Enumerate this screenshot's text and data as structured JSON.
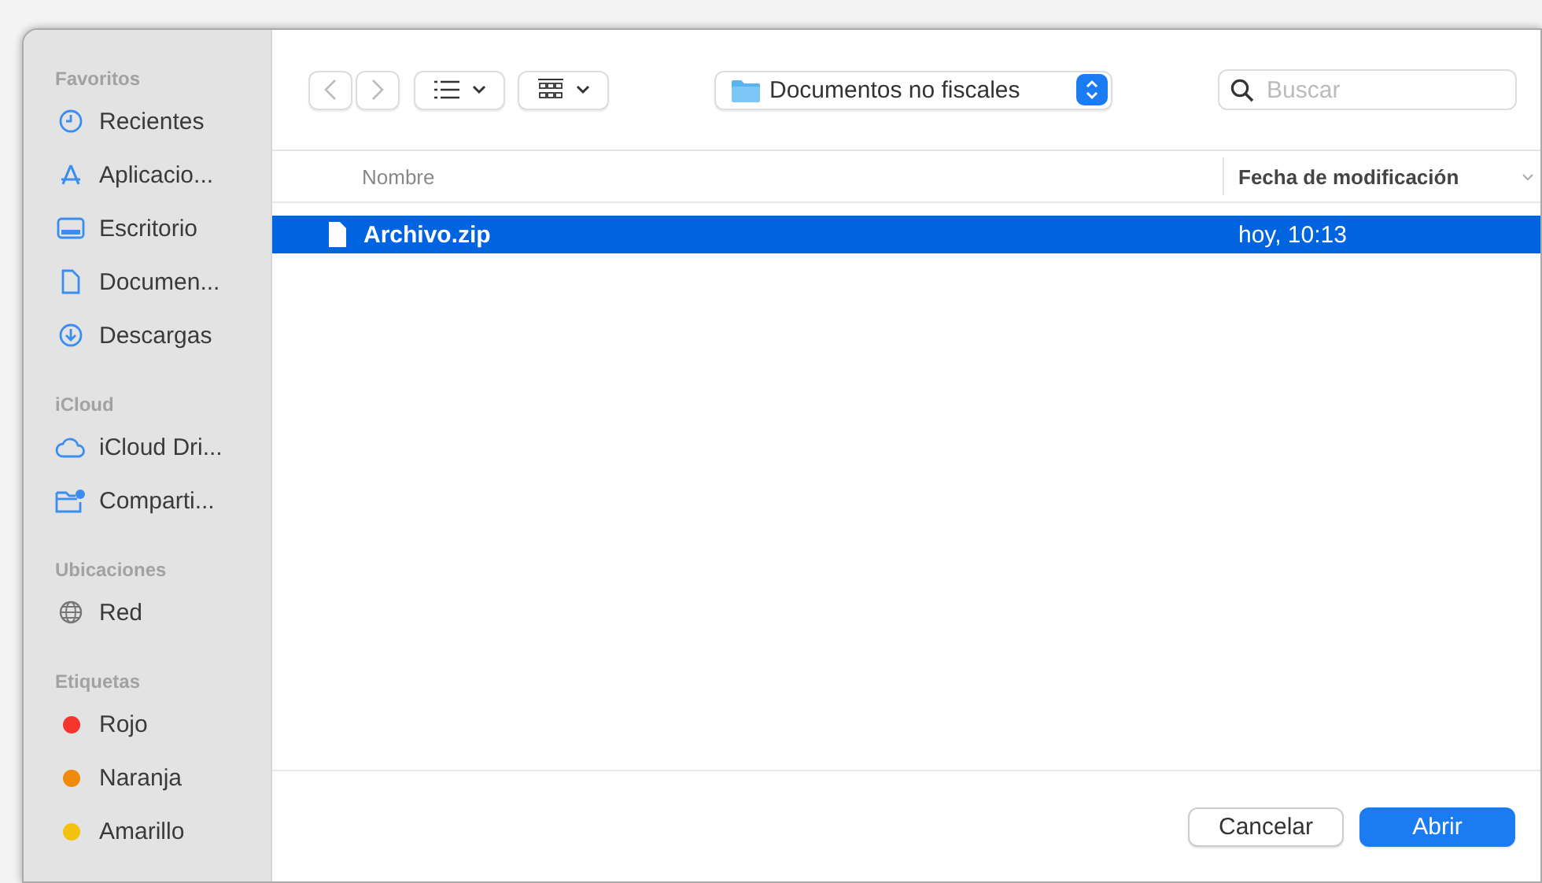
{
  "sidebar": {
    "sections": [
      {
        "title": "Favoritos",
        "items": [
          {
            "label": "Recientes",
            "kind": "place"
          },
          {
            "label": "Aplicacio...",
            "kind": "place"
          },
          {
            "label": "Escritorio",
            "kind": "place"
          },
          {
            "label": "Documen...",
            "kind": "place"
          },
          {
            "label": "Descargas",
            "kind": "place"
          }
        ]
      },
      {
        "title": "iCloud",
        "items": [
          {
            "label": "iCloud Dri...",
            "kind": "place"
          },
          {
            "label": "Comparti...",
            "kind": "place"
          }
        ]
      },
      {
        "title": "Ubicaciones",
        "items": [
          {
            "label": "Red",
            "kind": "place"
          }
        ]
      },
      {
        "title": "Etiquetas",
        "items": [
          {
            "label": "Rojo",
            "kind": "tag",
            "color": "#f5352e"
          },
          {
            "label": "Naranja",
            "kind": "tag",
            "color": "#f08a0c"
          },
          {
            "label": "Amarillo",
            "kind": "tag",
            "color": "#f2c20e"
          }
        ]
      }
    ]
  },
  "toolbar": {
    "location": "Documentos no fiscales",
    "search": {
      "placeholder": "Buscar"
    }
  },
  "file_list": {
    "columns": [
      "Nombre",
      "Fecha de modificación"
    ],
    "rows": [
      {
        "name": "Archivo.zip",
        "modified": "hoy, 10:13",
        "selected": true
      }
    ]
  },
  "buttons": [
    {
      "label": "Cancelar",
      "kind": "secondary"
    },
    {
      "label": "Abrir",
      "kind": "primary"
    }
  ]
}
